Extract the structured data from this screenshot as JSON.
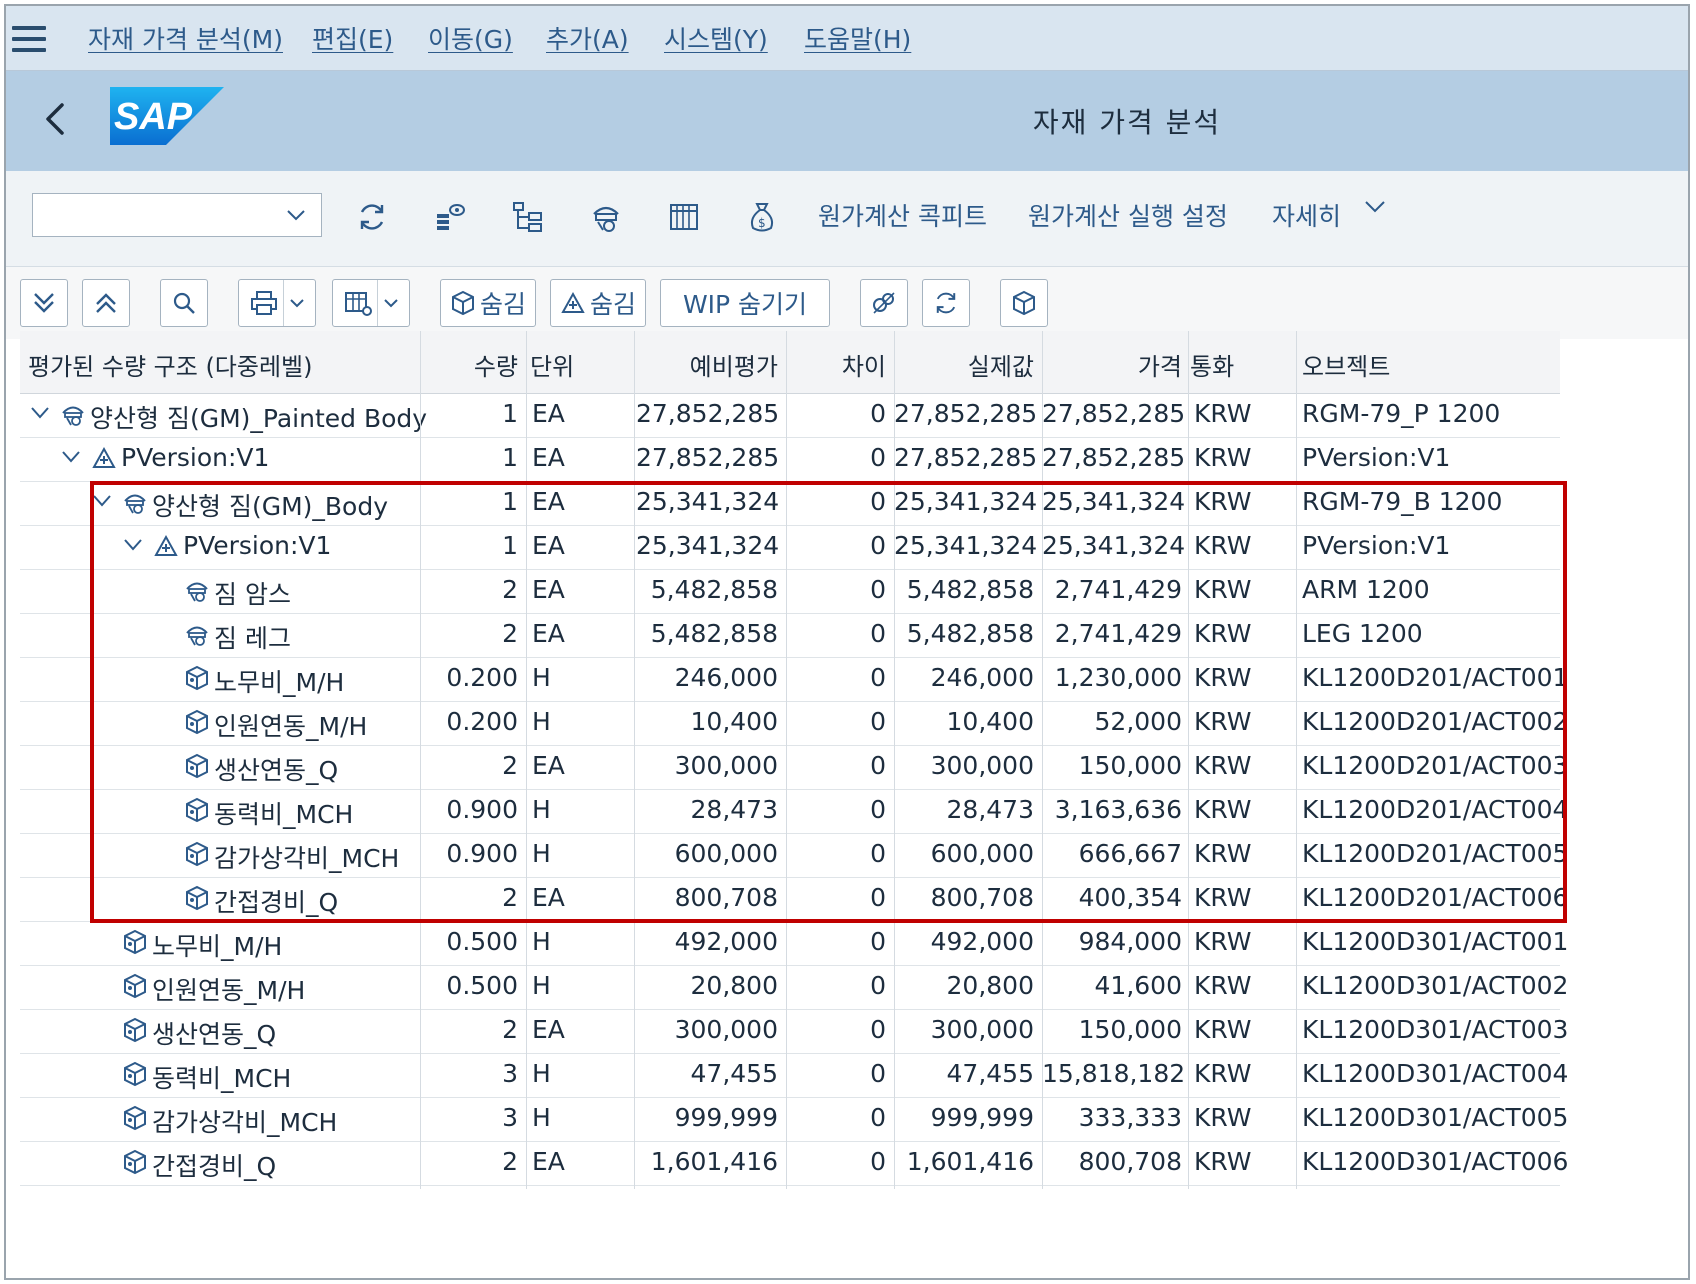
{
  "menu": [
    {
      "label": "자재 가격 분석(M)"
    },
    {
      "label": "편집(E)"
    },
    {
      "label": "이동(G)"
    },
    {
      "label": "추가(A)"
    },
    {
      "label": "시스템(Y)"
    },
    {
      "label": "도움말(H)"
    }
  ],
  "header": {
    "logo_text": "SAP",
    "title": "자재 가격 분석"
  },
  "toolbar1": {
    "combo_value": "",
    "cockpit": "원가계산 콕피트",
    "run_settings": "원가계산 실행 설정",
    "more": "자세히"
  },
  "toolbar2": {
    "hide1": "숨김",
    "hide2": "숨김",
    "wip": "WIP 숨기기"
  },
  "columns": [
    "평가된 수량 구조 (다중레벨)",
    "수량",
    "단위",
    "예비평가",
    "차이",
    "실제값",
    "가격",
    "통화",
    "오브젝트"
  ],
  "rows": [
    {
      "name": "양산형 짐(GM)_Painted Body",
      "icon": "material-icon",
      "level": 0,
      "expander": true,
      "qty": "1",
      "unit": "EA",
      "prelim": "27,852,285",
      "diff": "0",
      "actual": "27,852,285",
      "price": "27,852,285",
      "curr": "KRW",
      "obj": "RGM-79_P 1200"
    },
    {
      "name": "PVersion:V1",
      "icon": "procurement-icon",
      "level": 1,
      "expander": true,
      "qty": "1",
      "unit": "EA",
      "prelim": "27,852,285",
      "diff": "0",
      "actual": "27,852,285",
      "price": "27,852,285",
      "curr": "KRW",
      "obj": "PVersion:V1"
    },
    {
      "name": "양산형 짐(GM)_Body",
      "icon": "material-icon",
      "level": 2,
      "expander": true,
      "qty": "1",
      "unit": "EA",
      "prelim": "25,341,324",
      "diff": "0",
      "actual": "25,341,324",
      "price": "25,341,324",
      "curr": "KRW",
      "obj": "RGM-79_B 1200"
    },
    {
      "name": "PVersion:V1",
      "icon": "procurement-icon",
      "level": 3,
      "expander": true,
      "qty": "1",
      "unit": "EA",
      "prelim": "25,341,324",
      "diff": "0",
      "actual": "25,341,324",
      "price": "25,341,324",
      "curr": "KRW",
      "obj": "PVersion:V1"
    },
    {
      "name": "짐 암스",
      "icon": "material-icon",
      "level": 4,
      "expander": false,
      "qty": "2",
      "unit": "EA",
      "prelim": "5,482,858",
      "diff": "0",
      "actual": "5,482,858",
      "price": "2,741,429",
      "curr": "KRW",
      "obj": "ARM 1200"
    },
    {
      "name": "짐 레그",
      "icon": "material-icon",
      "level": 4,
      "expander": false,
      "qty": "2",
      "unit": "EA",
      "prelim": "5,482,858",
      "diff": "0",
      "actual": "5,482,858",
      "price": "2,741,429",
      "curr": "KRW",
      "obj": "LEG 1200"
    },
    {
      "name": "노무비_M/H",
      "icon": "activity-icon",
      "level": 4,
      "expander": false,
      "qty": "0.200",
      "unit": "H",
      "prelim": "246,000",
      "diff": "0",
      "actual": "246,000",
      "price": "1,230,000",
      "curr": "KRW",
      "obj": "KL1200D201/ACT001"
    },
    {
      "name": "인원연동_M/H",
      "icon": "activity-icon",
      "level": 4,
      "expander": false,
      "qty": "0.200",
      "unit": "H",
      "prelim": "10,400",
      "diff": "0",
      "actual": "10,400",
      "price": "52,000",
      "curr": "KRW",
      "obj": "KL1200D201/ACT002"
    },
    {
      "name": "생산연동_Q",
      "icon": "activity-icon",
      "level": 4,
      "expander": false,
      "qty": "2",
      "unit": "EA",
      "prelim": "300,000",
      "diff": "0",
      "actual": "300,000",
      "price": "150,000",
      "curr": "KRW",
      "obj": "KL1200D201/ACT003"
    },
    {
      "name": "동력비_MCH",
      "icon": "activity-icon",
      "level": 4,
      "expander": false,
      "qty": "0.900",
      "unit": "H",
      "prelim": "28,473",
      "diff": "0",
      "actual": "28,473",
      "price": "3,163,636",
      "curr": "KRW",
      "obj": "KL1200D201/ACT004"
    },
    {
      "name": "감가상각비_MCH",
      "icon": "activity-icon",
      "level": 4,
      "expander": false,
      "qty": "0.900",
      "unit": "H",
      "prelim": "600,000",
      "diff": "0",
      "actual": "600,000",
      "price": "666,667",
      "curr": "KRW",
      "obj": "KL1200D201/ACT005"
    },
    {
      "name": "간접경비_Q",
      "icon": "activity-icon",
      "level": 4,
      "expander": false,
      "qty": "2",
      "unit": "EA",
      "prelim": "800,708",
      "diff": "0",
      "actual": "800,708",
      "price": "400,354",
      "curr": "KRW",
      "obj": "KL1200D201/ACT006"
    },
    {
      "name": "노무비_M/H",
      "icon": "activity-icon",
      "level": 2,
      "expander": false,
      "qty": "0.500",
      "unit": "H",
      "prelim": "492,000",
      "diff": "0",
      "actual": "492,000",
      "price": "984,000",
      "curr": "KRW",
      "obj": "KL1200D301/ACT001"
    },
    {
      "name": "인원연동_M/H",
      "icon": "activity-icon",
      "level": 2,
      "expander": false,
      "qty": "0.500",
      "unit": "H",
      "prelim": "20,800",
      "diff": "0",
      "actual": "20,800",
      "price": "41,600",
      "curr": "KRW",
      "obj": "KL1200D301/ACT002"
    },
    {
      "name": "생산연동_Q",
      "icon": "activity-icon",
      "level": 2,
      "expander": false,
      "qty": "2",
      "unit": "EA",
      "prelim": "300,000",
      "diff": "0",
      "actual": "300,000",
      "price": "150,000",
      "curr": "KRW",
      "obj": "KL1200D301/ACT003"
    },
    {
      "name": "동력비_MCH",
      "icon": "activity-icon",
      "level": 2,
      "expander": false,
      "qty": "3",
      "unit": "H",
      "prelim": "47,455",
      "diff": "0",
      "actual": "47,455",
      "price": "15,818,182",
      "curr": "KRW",
      "obj": "KL1200D301/ACT004"
    },
    {
      "name": "감가상각비_MCH",
      "icon": "activity-icon",
      "level": 2,
      "expander": false,
      "qty": "3",
      "unit": "H",
      "prelim": "999,999",
      "diff": "0",
      "actual": "999,999",
      "price": "333,333",
      "curr": "KRW",
      "obj": "KL1200D301/ACT005"
    },
    {
      "name": "간접경비_Q",
      "icon": "activity-icon",
      "level": 2,
      "expander": false,
      "qty": "2",
      "unit": "EA",
      "prelim": "1,601,416",
      "diff": "0",
      "actual": "1,601,416",
      "price": "800,708",
      "curr": "KRW",
      "obj": "KL1200D301/ACT006"
    }
  ],
  "colors": {
    "highlight": "#c00000",
    "brand": "#1a9be0",
    "menu_bg": "#d9e5f0",
    "title_bg": "#b4cde3"
  }
}
